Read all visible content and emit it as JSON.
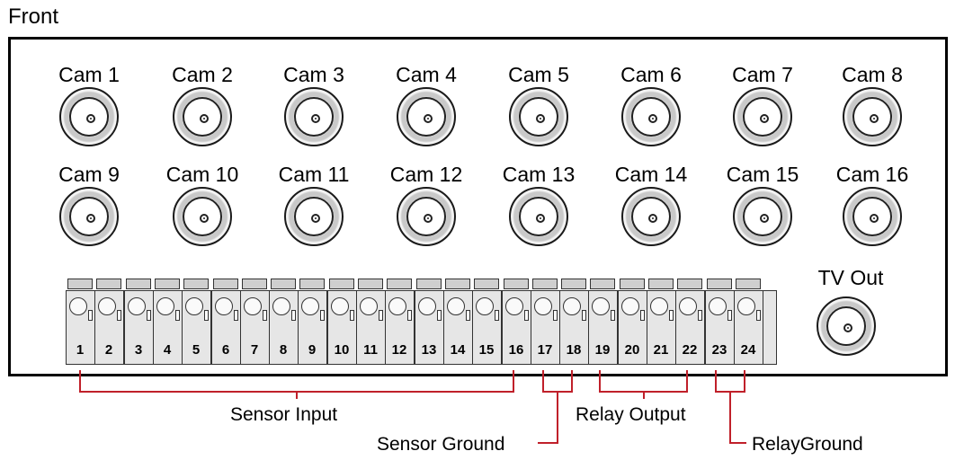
{
  "title": "Front",
  "cameras": [
    "Cam 1",
    "Cam 2",
    "Cam 3",
    "Cam 4",
    "Cam 5",
    "Cam 6",
    "Cam 7",
    "Cam 8",
    "Cam 9",
    "Cam 10",
    "Cam 11",
    "Cam 12",
    "Cam 13",
    "Cam 14",
    "Cam 15",
    "Cam 16"
  ],
  "tv_out_label": "TV Out",
  "terminals": [
    "1",
    "2",
    "3",
    "4",
    "5",
    "6",
    "7",
    "8",
    "9",
    "10",
    "11",
    "12",
    "13",
    "14",
    "15",
    "16",
    "17",
    "18",
    "19",
    "20",
    "21",
    "22",
    "23",
    "24"
  ],
  "groups": {
    "sensor_input": "Sensor Input",
    "sensor_ground": "Sensor Ground",
    "relay_output": "Relay Output",
    "relay_ground": "RelayGround"
  },
  "colors": {
    "wire": "#c0202a",
    "panel_border": "#000000"
  },
  "icons": {
    "connector": "bnc-connector-icon",
    "terminal": "terminal-block"
  }
}
